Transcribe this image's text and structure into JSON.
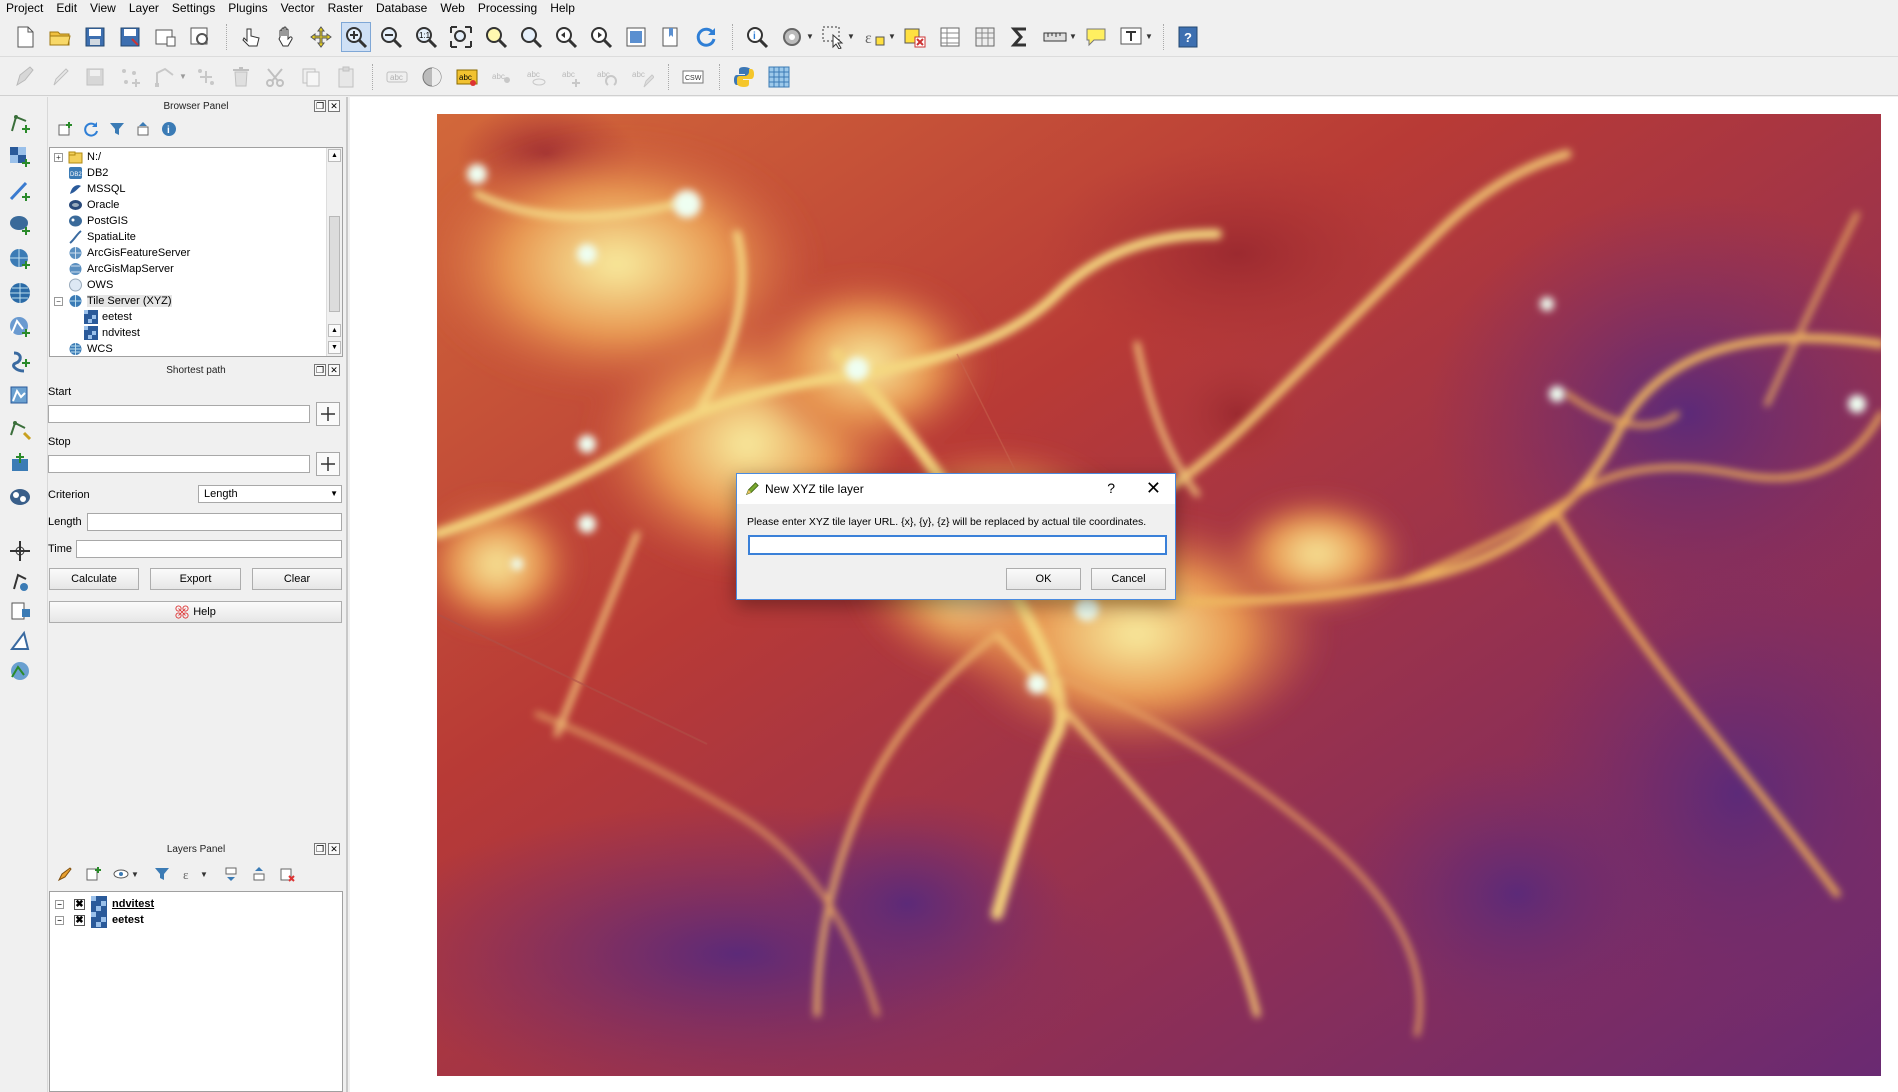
{
  "menubar": [
    "Project",
    "Edit",
    "View",
    "Layer",
    "Settings",
    "Plugins",
    "Vector",
    "Raster",
    "Database",
    "Web",
    "Processing",
    "Help"
  ],
  "browser_panel": {
    "title": "Browser Panel",
    "items": [
      {
        "label": "N:/",
        "icon": "folder-icon",
        "expander": "+"
      },
      {
        "label": "DB2",
        "icon": "db2-icon",
        "expander": ""
      },
      {
        "label": "MSSQL",
        "icon": "mssql-icon",
        "expander": ""
      },
      {
        "label": "Oracle",
        "icon": "oracle-icon",
        "expander": ""
      },
      {
        "label": "PostGIS",
        "icon": "postgis-icon",
        "expander": ""
      },
      {
        "label": "SpatiaLite",
        "icon": "spatialite-icon",
        "expander": ""
      },
      {
        "label": "ArcGisFeatureServer",
        "icon": "arcgis-feature-server-icon",
        "expander": ""
      },
      {
        "label": "ArcGisMapServer",
        "icon": "arcgis-map-server-icon",
        "expander": ""
      },
      {
        "label": "OWS",
        "icon": "ows-icon",
        "expander": ""
      },
      {
        "label": "Tile Server (XYZ)",
        "icon": "tile-server-icon",
        "expander": "−"
      },
      {
        "label": "eetest",
        "icon": "raster-layer-icon",
        "expander": "",
        "child": true
      },
      {
        "label": "ndvitest",
        "icon": "raster-layer-icon",
        "expander": "",
        "child": true
      },
      {
        "label": "WCS",
        "icon": "wcs-icon",
        "expander": ""
      }
    ]
  },
  "shortest_path": {
    "title": "Shortest path",
    "start_label": "Start",
    "start_value": "",
    "stop_label": "Stop",
    "stop_value": "",
    "criterion_label": "Criterion",
    "criterion_value": "Length",
    "length_label": "Length",
    "length_value": "",
    "time_label": "Time",
    "time_value": "",
    "calculate": "Calculate",
    "export": "Export",
    "clear": "Clear",
    "help": "Help"
  },
  "layers_panel": {
    "title": "Layers Panel",
    "layers": [
      {
        "label": "ndvitest",
        "checked": "✖",
        "underline": true
      },
      {
        "label": "eetest",
        "checked": "✖",
        "underline": false
      }
    ]
  },
  "dialog": {
    "title": "New XYZ tile layer",
    "help": "?",
    "close": "✕",
    "message": "Please enter XYZ tile layer URL. {x}, {y}, {z} will be replaced by actual tile coordinates.",
    "input_value": "",
    "ok": "OK",
    "cancel": "Cancel"
  },
  "colors": {
    "accent": "#3a80d8",
    "map_low": "#6a2e86",
    "map_mid": "#c8492c",
    "map_high": "#f3e49a",
    "map_peak": "#e8fff5"
  }
}
